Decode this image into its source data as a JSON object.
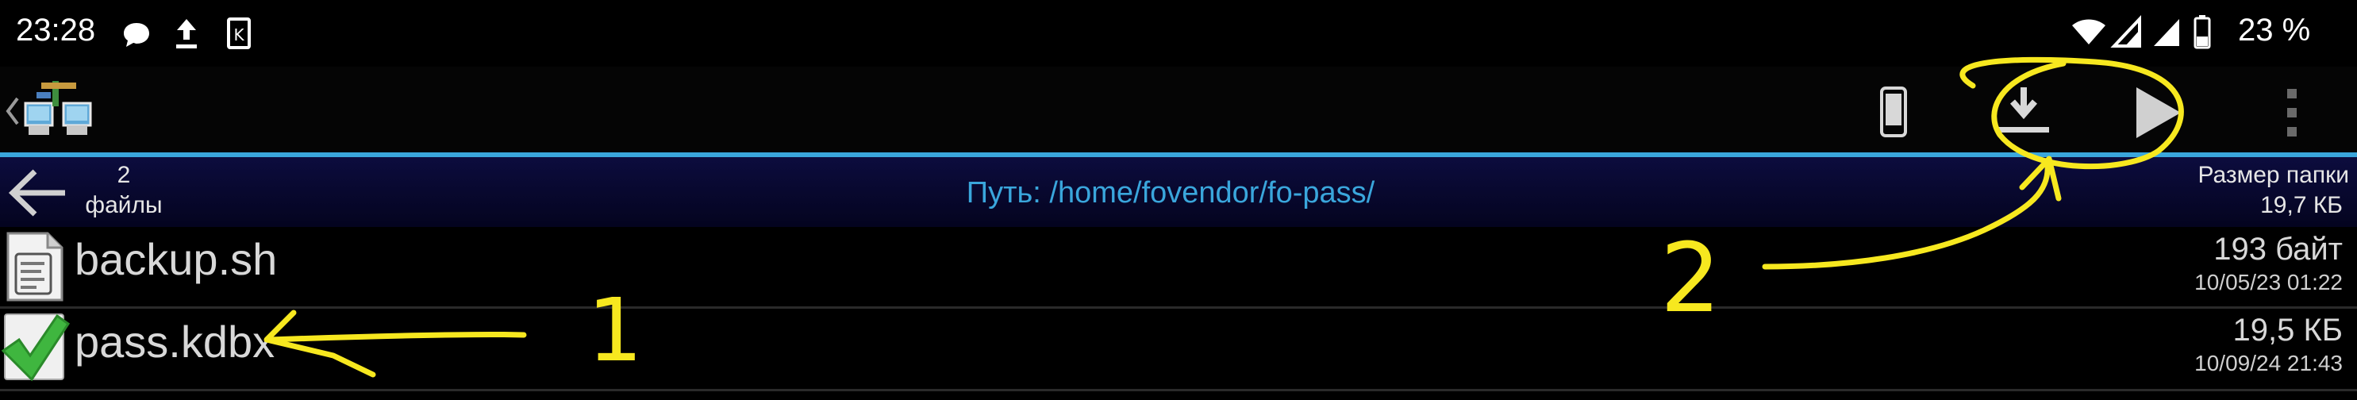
{
  "status_bar": {
    "time": "23:28",
    "icons": [
      "chat-bubble-icon",
      "upload-icon",
      "k-notification-icon"
    ],
    "right_icons": [
      "wifi-icon",
      "signal-icon",
      "signal-icon-2",
      "battery-icon"
    ],
    "battery": "23 %"
  },
  "toolbar": {
    "app_icon": "ftp-network-computers-icon",
    "actions": [
      "phone-icon",
      "download-icon",
      "play-icon",
      "more-vert-icon"
    ]
  },
  "path_bar": {
    "file_count": "2",
    "file_count_label": "файлы",
    "path": "Путь: /home/fovendor/fo-pass/",
    "folder_size_label": "Размер папки",
    "folder_size_value": "19,7 КБ"
  },
  "files": [
    {
      "name": "backup.sh",
      "size": "193 байт",
      "date": "10/05/23 01:22",
      "icon": "text-file-icon"
    },
    {
      "name": "pass.kdbx",
      "size": "19,5 КБ",
      "date": "10/09/24 21:43",
      "icon": "checkmark-icon"
    }
  ],
  "annotations": {
    "label_1": "1",
    "label_2": "2",
    "color": "#f7e81f"
  },
  "colors": {
    "accent": "#3aa6dc",
    "path_bar": "#0c0c3e",
    "annotation": "#f7e81f"
  }
}
